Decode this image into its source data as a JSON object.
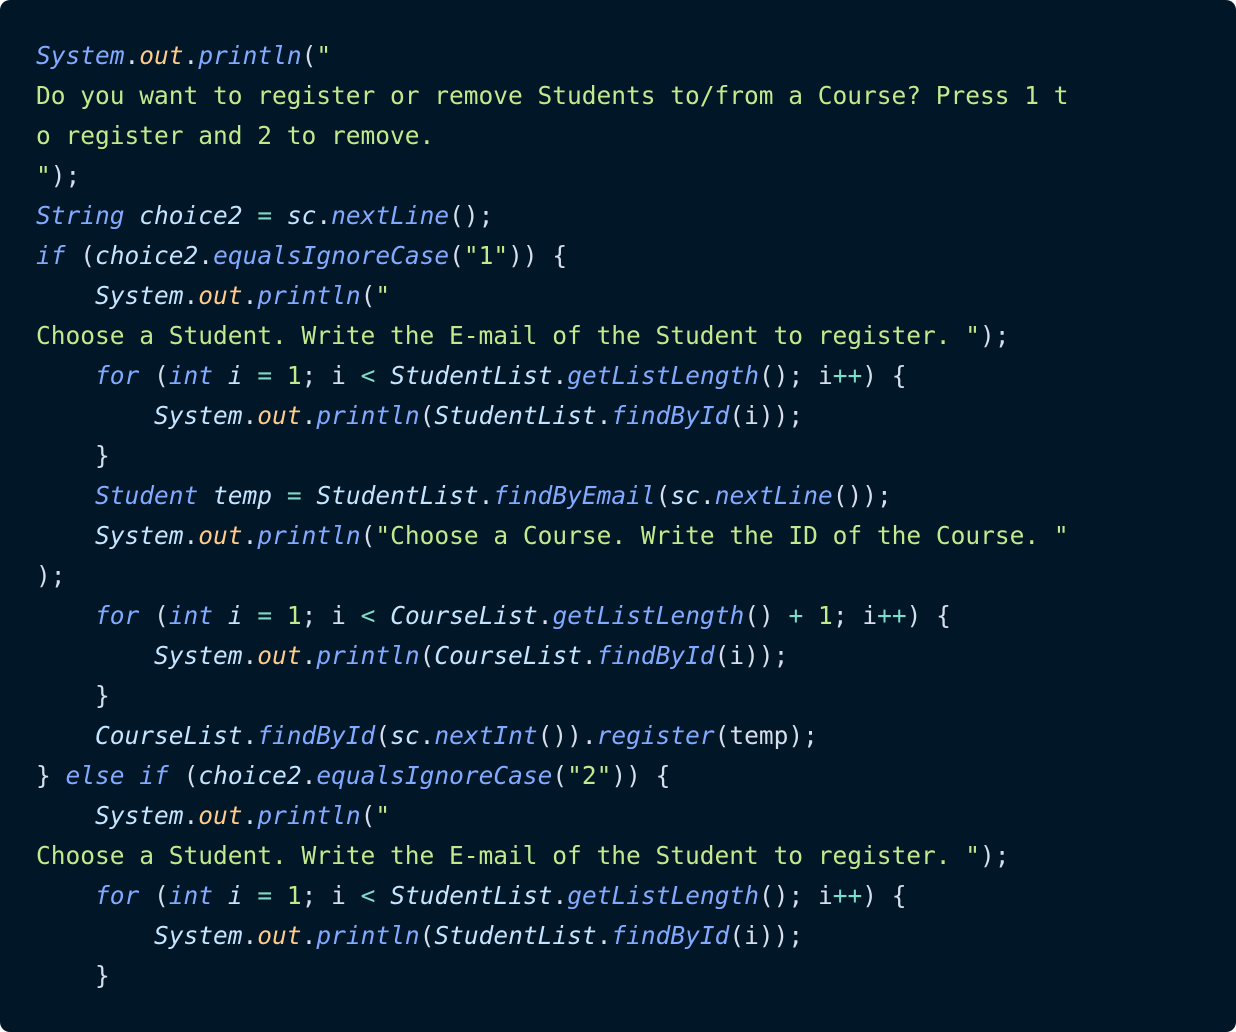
{
  "code": {
    "language": "java",
    "colors": {
      "background": "#011627",
      "default": "#d6deeb",
      "class": "#82aaff",
      "property": "#ffcb8b",
      "method": "#82aaff",
      "keyword": "#c792ea",
      "variable": "#c5e4fd",
      "string": "#c3e88d",
      "number": "#c3e88d",
      "operator": "#7fdbca"
    },
    "lines": [
      [
        {
          "t": "System",
          "k": "cls"
        },
        {
          "t": ".",
          "k": "punc"
        },
        {
          "t": "out",
          "k": "prop"
        },
        {
          "t": ".",
          "k": "punc"
        },
        {
          "t": "println",
          "k": "fn"
        },
        {
          "t": "(",
          "k": "punc"
        },
        {
          "t": "\"",
          "k": "str"
        }
      ],
      [
        {
          "t": "Do you want to register or remove Students to/from a Course? Press 1 t",
          "k": "str"
        }
      ],
      [
        {
          "t": "o register and 2 to remove.",
          "k": "str"
        }
      ],
      [
        {
          "t": "\"",
          "k": "str"
        },
        {
          "t": ");",
          "k": "punc"
        }
      ],
      [
        {
          "t": "String",
          "k": "cls"
        },
        {
          "t": " ",
          "k": "plain"
        },
        {
          "t": "choice2",
          "k": "var"
        },
        {
          "t": " ",
          "k": "plain"
        },
        {
          "t": "=",
          "k": "op"
        },
        {
          "t": " ",
          "k": "plain"
        },
        {
          "t": "sc",
          "k": "var"
        },
        {
          "t": ".",
          "k": "punc"
        },
        {
          "t": "nextLine",
          "k": "fn"
        },
        {
          "t": "();",
          "k": "punc"
        }
      ],
      [
        {
          "t": "if",
          "k": "cls"
        },
        {
          "t": " (",
          "k": "punc"
        },
        {
          "t": "choice2",
          "k": "var"
        },
        {
          "t": ".",
          "k": "punc"
        },
        {
          "t": "equalsIgnoreCase",
          "k": "fn"
        },
        {
          "t": "(",
          "k": "punc"
        },
        {
          "t": "\"1\"",
          "k": "str"
        },
        {
          "t": ")) {",
          "k": "punc"
        }
      ],
      [
        {
          "t": "    ",
          "k": "plain"
        },
        {
          "t": "System",
          "k": "var"
        },
        {
          "t": ".",
          "k": "punc"
        },
        {
          "t": "out",
          "k": "prop"
        },
        {
          "t": ".",
          "k": "punc"
        },
        {
          "t": "println",
          "k": "fn"
        },
        {
          "t": "(",
          "k": "punc"
        },
        {
          "t": "\"",
          "k": "str"
        }
      ],
      [
        {
          "t": "Choose a Student. Write the E-mail of the Student to register. \"",
          "k": "str"
        },
        {
          "t": ");",
          "k": "punc"
        }
      ],
      [
        {
          "t": "    ",
          "k": "plain"
        },
        {
          "t": "for",
          "k": "cls"
        },
        {
          "t": " (",
          "k": "punc"
        },
        {
          "t": "int",
          "k": "cls"
        },
        {
          "t": " ",
          "k": "plain"
        },
        {
          "t": "i",
          "k": "var"
        },
        {
          "t": " ",
          "k": "plain"
        },
        {
          "t": "=",
          "k": "op"
        },
        {
          "t": " ",
          "k": "plain"
        },
        {
          "t": "1",
          "k": "num"
        },
        {
          "t": "; i ",
          "k": "punc"
        },
        {
          "t": "<",
          "k": "op"
        },
        {
          "t": " ",
          "k": "plain"
        },
        {
          "t": "StudentList",
          "k": "var"
        },
        {
          "t": ".",
          "k": "punc"
        },
        {
          "t": "getListLength",
          "k": "fn"
        },
        {
          "t": "(); i",
          "k": "punc"
        },
        {
          "t": "++",
          "k": "op"
        },
        {
          "t": ") {",
          "k": "punc"
        }
      ],
      [
        {
          "t": "        ",
          "k": "plain"
        },
        {
          "t": "System",
          "k": "var"
        },
        {
          "t": ".",
          "k": "punc"
        },
        {
          "t": "out",
          "k": "prop"
        },
        {
          "t": ".",
          "k": "punc"
        },
        {
          "t": "println",
          "k": "fn"
        },
        {
          "t": "(",
          "k": "punc"
        },
        {
          "t": "StudentList",
          "k": "var"
        },
        {
          "t": ".",
          "k": "punc"
        },
        {
          "t": "findById",
          "k": "fn"
        },
        {
          "t": "(i));",
          "k": "punc"
        }
      ],
      [
        {
          "t": "    }",
          "k": "punc"
        }
      ],
      [
        {
          "t": "    ",
          "k": "plain"
        },
        {
          "t": "Student",
          "k": "cls"
        },
        {
          "t": " ",
          "k": "plain"
        },
        {
          "t": "temp",
          "k": "var"
        },
        {
          "t": " ",
          "k": "plain"
        },
        {
          "t": "=",
          "k": "op"
        },
        {
          "t": " ",
          "k": "plain"
        },
        {
          "t": "StudentList",
          "k": "var"
        },
        {
          "t": ".",
          "k": "punc"
        },
        {
          "t": "findByEmail",
          "k": "fn"
        },
        {
          "t": "(",
          "k": "punc"
        },
        {
          "t": "sc",
          "k": "var"
        },
        {
          "t": ".",
          "k": "punc"
        },
        {
          "t": "nextLine",
          "k": "fn"
        },
        {
          "t": "());",
          "k": "punc"
        }
      ],
      [
        {
          "t": "    ",
          "k": "plain"
        },
        {
          "t": "System",
          "k": "var"
        },
        {
          "t": ".",
          "k": "punc"
        },
        {
          "t": "out",
          "k": "prop"
        },
        {
          "t": ".",
          "k": "punc"
        },
        {
          "t": "println",
          "k": "fn"
        },
        {
          "t": "(",
          "k": "punc"
        },
        {
          "t": "\"Choose a Course. Write the ID of the Course. \"",
          "k": "str"
        }
      ],
      [
        {
          "t": ");",
          "k": "punc"
        }
      ],
      [
        {
          "t": "    ",
          "k": "plain"
        },
        {
          "t": "for",
          "k": "cls"
        },
        {
          "t": " (",
          "k": "punc"
        },
        {
          "t": "int",
          "k": "cls"
        },
        {
          "t": " ",
          "k": "plain"
        },
        {
          "t": "i",
          "k": "var"
        },
        {
          "t": " ",
          "k": "plain"
        },
        {
          "t": "=",
          "k": "op"
        },
        {
          "t": " ",
          "k": "plain"
        },
        {
          "t": "1",
          "k": "num"
        },
        {
          "t": "; i ",
          "k": "punc"
        },
        {
          "t": "<",
          "k": "op"
        },
        {
          "t": " ",
          "k": "plain"
        },
        {
          "t": "CourseList",
          "k": "var"
        },
        {
          "t": ".",
          "k": "punc"
        },
        {
          "t": "getListLength",
          "k": "fn"
        },
        {
          "t": "() ",
          "k": "punc"
        },
        {
          "t": "+",
          "k": "op"
        },
        {
          "t": " ",
          "k": "plain"
        },
        {
          "t": "1",
          "k": "num"
        },
        {
          "t": "; i",
          "k": "punc"
        },
        {
          "t": "++",
          "k": "op"
        },
        {
          "t": ") {",
          "k": "punc"
        }
      ],
      [
        {
          "t": "        ",
          "k": "plain"
        },
        {
          "t": "System",
          "k": "var"
        },
        {
          "t": ".",
          "k": "punc"
        },
        {
          "t": "out",
          "k": "prop"
        },
        {
          "t": ".",
          "k": "punc"
        },
        {
          "t": "println",
          "k": "fn"
        },
        {
          "t": "(",
          "k": "punc"
        },
        {
          "t": "CourseList",
          "k": "var"
        },
        {
          "t": ".",
          "k": "punc"
        },
        {
          "t": "findById",
          "k": "fn"
        },
        {
          "t": "(i));",
          "k": "punc"
        }
      ],
      [
        {
          "t": "    }",
          "k": "punc"
        }
      ],
      [
        {
          "t": "    ",
          "k": "plain"
        },
        {
          "t": "CourseList",
          "k": "var"
        },
        {
          "t": ".",
          "k": "punc"
        },
        {
          "t": "findById",
          "k": "fn"
        },
        {
          "t": "(",
          "k": "punc"
        },
        {
          "t": "sc",
          "k": "var"
        },
        {
          "t": ".",
          "k": "punc"
        },
        {
          "t": "nextInt",
          "k": "fn"
        },
        {
          "t": "()).",
          "k": "punc"
        },
        {
          "t": "register",
          "k": "fn"
        },
        {
          "t": "(temp);",
          "k": "punc"
        }
      ],
      [
        {
          "t": "} ",
          "k": "punc"
        },
        {
          "t": "else",
          "k": "cls"
        },
        {
          "t": " ",
          "k": "plain"
        },
        {
          "t": "if",
          "k": "cls"
        },
        {
          "t": " (",
          "k": "punc"
        },
        {
          "t": "choice2",
          "k": "var"
        },
        {
          "t": ".",
          "k": "punc"
        },
        {
          "t": "equalsIgnoreCase",
          "k": "fn"
        },
        {
          "t": "(",
          "k": "punc"
        },
        {
          "t": "\"2\"",
          "k": "str"
        },
        {
          "t": ")) {",
          "k": "punc"
        }
      ],
      [
        {
          "t": "    ",
          "k": "plain"
        },
        {
          "t": "System",
          "k": "var"
        },
        {
          "t": ".",
          "k": "punc"
        },
        {
          "t": "out",
          "k": "prop"
        },
        {
          "t": ".",
          "k": "punc"
        },
        {
          "t": "println",
          "k": "fn"
        },
        {
          "t": "(",
          "k": "punc"
        },
        {
          "t": "\"",
          "k": "str"
        }
      ],
      [
        {
          "t": "Choose a Student. Write the E-mail of the Student to register. \"",
          "k": "str"
        },
        {
          "t": ");",
          "k": "punc"
        }
      ],
      [
        {
          "t": "    ",
          "k": "plain"
        },
        {
          "t": "for",
          "k": "cls"
        },
        {
          "t": " (",
          "k": "punc"
        },
        {
          "t": "int",
          "k": "cls"
        },
        {
          "t": " ",
          "k": "plain"
        },
        {
          "t": "i",
          "k": "var"
        },
        {
          "t": " ",
          "k": "plain"
        },
        {
          "t": "=",
          "k": "op"
        },
        {
          "t": " ",
          "k": "plain"
        },
        {
          "t": "1",
          "k": "num"
        },
        {
          "t": "; i ",
          "k": "punc"
        },
        {
          "t": "<",
          "k": "op"
        },
        {
          "t": " ",
          "k": "plain"
        },
        {
          "t": "StudentList",
          "k": "var"
        },
        {
          "t": ".",
          "k": "punc"
        },
        {
          "t": "getListLength",
          "k": "fn"
        },
        {
          "t": "(); i",
          "k": "punc"
        },
        {
          "t": "++",
          "k": "op"
        },
        {
          "t": ") {",
          "k": "punc"
        }
      ],
      [
        {
          "t": "        ",
          "k": "plain"
        },
        {
          "t": "System",
          "k": "var"
        },
        {
          "t": ".",
          "k": "punc"
        },
        {
          "t": "out",
          "k": "prop"
        },
        {
          "t": ".",
          "k": "punc"
        },
        {
          "t": "println",
          "k": "fn"
        },
        {
          "t": "(",
          "k": "punc"
        },
        {
          "t": "StudentList",
          "k": "var"
        },
        {
          "t": ".",
          "k": "punc"
        },
        {
          "t": "findById",
          "k": "fn"
        },
        {
          "t": "(i));",
          "k": "punc"
        }
      ],
      [
        {
          "t": "    }",
          "k": "punc"
        }
      ]
    ]
  }
}
